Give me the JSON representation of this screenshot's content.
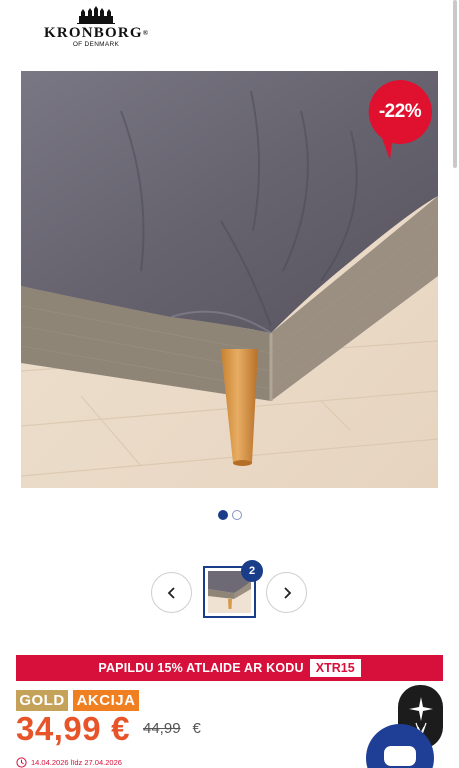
{
  "brand": {
    "name": "KRONBORG",
    "registered": "®",
    "subtitle": "OF DENMARK"
  },
  "product_image": {
    "discount_badge": "-22%"
  },
  "gallery": {
    "slide_count": 2,
    "active_slide": 1,
    "thumbnail_count": "2"
  },
  "promo": {
    "text": "PAPILDU 15% ATLAIDE AR KODU",
    "code": "XTR15"
  },
  "tags": {
    "gold": "GOLD",
    "sale": "AKCIJA"
  },
  "pricing": {
    "price": "34,99",
    "currency": "€",
    "old_price": "44,99",
    "old_currency": "€",
    "validity": "14.04.2026 līdz 27.04.2026"
  },
  "colors": {
    "accent_blue": "#1a3d8a",
    "promo_red": "#d6103b",
    "price_orange": "#e7542a",
    "gold_tag": "#c5a25a",
    "sale_tag": "#f07f22"
  },
  "icons": {
    "prev": "chevron-left-icon",
    "next": "chevron-right-icon",
    "clock": "clock-icon",
    "ai": "sparkle-icon",
    "chat": "chat-bubble-icon"
  }
}
